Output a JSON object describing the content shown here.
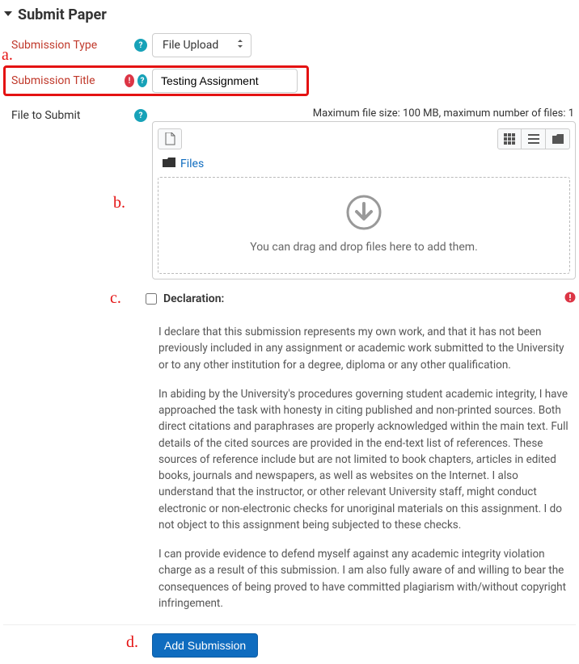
{
  "annotations": {
    "a": "a.",
    "b": "b.",
    "c": "c.",
    "d": "d."
  },
  "header": {
    "title": "Submit Paper"
  },
  "fields": {
    "submission_type": {
      "label": "Submission Type",
      "value": "File Upload"
    },
    "submission_title": {
      "label": "Submission Title",
      "value": "Testing Assignment"
    },
    "file_to_submit": {
      "label": "File to Submit",
      "limits": "Maximum file size: 100 MB, maximum number of files: 1",
      "path_label": "Files",
      "dropzone_text": "You can drag and drop files here to add them."
    }
  },
  "declaration": {
    "label": "Declaration:",
    "paragraphs": [
      "I declare that this submission represents my own work, and that it has not been previously included in any assignment or academic work submitted to the University or to any other institution for a degree, diploma or any other qualification.",
      "In abiding by the University's procedures governing student academic integrity, I have approached the task with honesty in citing published and non-printed sources. Both direct citations and paraphrases are properly acknowledged within the main text. Full details of the cited sources are provided in the end-text list of references. These sources of reference include but are not limited to book chapters, articles in edited books, journals and newspapers, as well as websites on the Internet. I also understand that the instructor, or other relevant University staff, might conduct electronic or non-electronic checks for unoriginal materials on this assignment. I do not object to this assignment being subjected to these checks.",
      "I can provide evidence to defend myself against any academic integrity violation charge as a result of this submission. I am also fully aware of and willing to bear the consequences of being proved to have committed plagiarism with/without copyright infringement."
    ]
  },
  "footer": {
    "submit_label": "Add Submission"
  },
  "icons": {
    "help_glyph": "?",
    "req_glyph": "!",
    "grid": "▦",
    "list": "☰",
    "folder": "■",
    "doc": "🗎",
    "folder2": "■",
    "updown": "⇵"
  }
}
